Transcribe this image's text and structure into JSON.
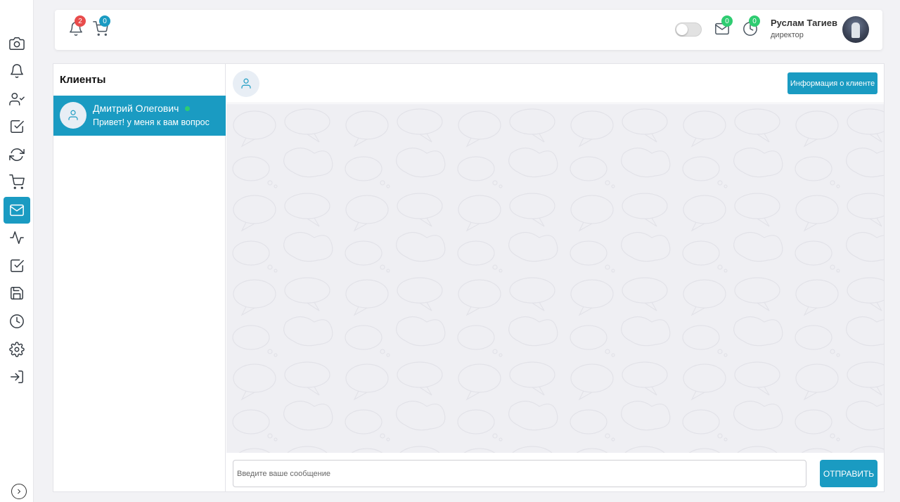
{
  "sidebar": {
    "items": [
      {
        "icon": "camera-icon",
        "active": false
      },
      {
        "icon": "bell-icon",
        "active": false
      },
      {
        "icon": "user-check-icon",
        "active": false
      },
      {
        "icon": "check-square-icon",
        "active": false
      },
      {
        "icon": "refresh-icon",
        "active": false
      },
      {
        "icon": "cart-icon",
        "active": false
      },
      {
        "icon": "mail-icon",
        "active": true
      },
      {
        "icon": "activity-icon",
        "active": false
      },
      {
        "icon": "check-square-icon",
        "active": false
      },
      {
        "icon": "save-icon",
        "active": false
      },
      {
        "icon": "clock-icon",
        "active": false
      },
      {
        "icon": "settings-icon",
        "active": false
      },
      {
        "icon": "log-in-icon",
        "active": false
      }
    ],
    "collapse_icon": "chevron-right-icon"
  },
  "header": {
    "notifications_count": "2",
    "cart_count": "0",
    "mail_count": "0",
    "clock_count": "0",
    "user_name": "Руслам Тагиев",
    "user_role": "директор"
  },
  "clients": {
    "title": "Клиенты",
    "items": [
      {
        "name": "Дмитрий Олегович",
        "last_message": "Привет! у меня к вам вопрос",
        "online": true
      }
    ]
  },
  "chat": {
    "info_button": "Информация о клиенте",
    "input_placeholder": "Введите ваше сообщение",
    "send_button": "ОТПРАВИТЬ"
  },
  "colors": {
    "accent": "#1a9bc2",
    "badge_red": "#e84c4c",
    "badge_blue": "#1a9bc2",
    "badge_green": "#2ecc71",
    "online": "#2ecc71"
  }
}
